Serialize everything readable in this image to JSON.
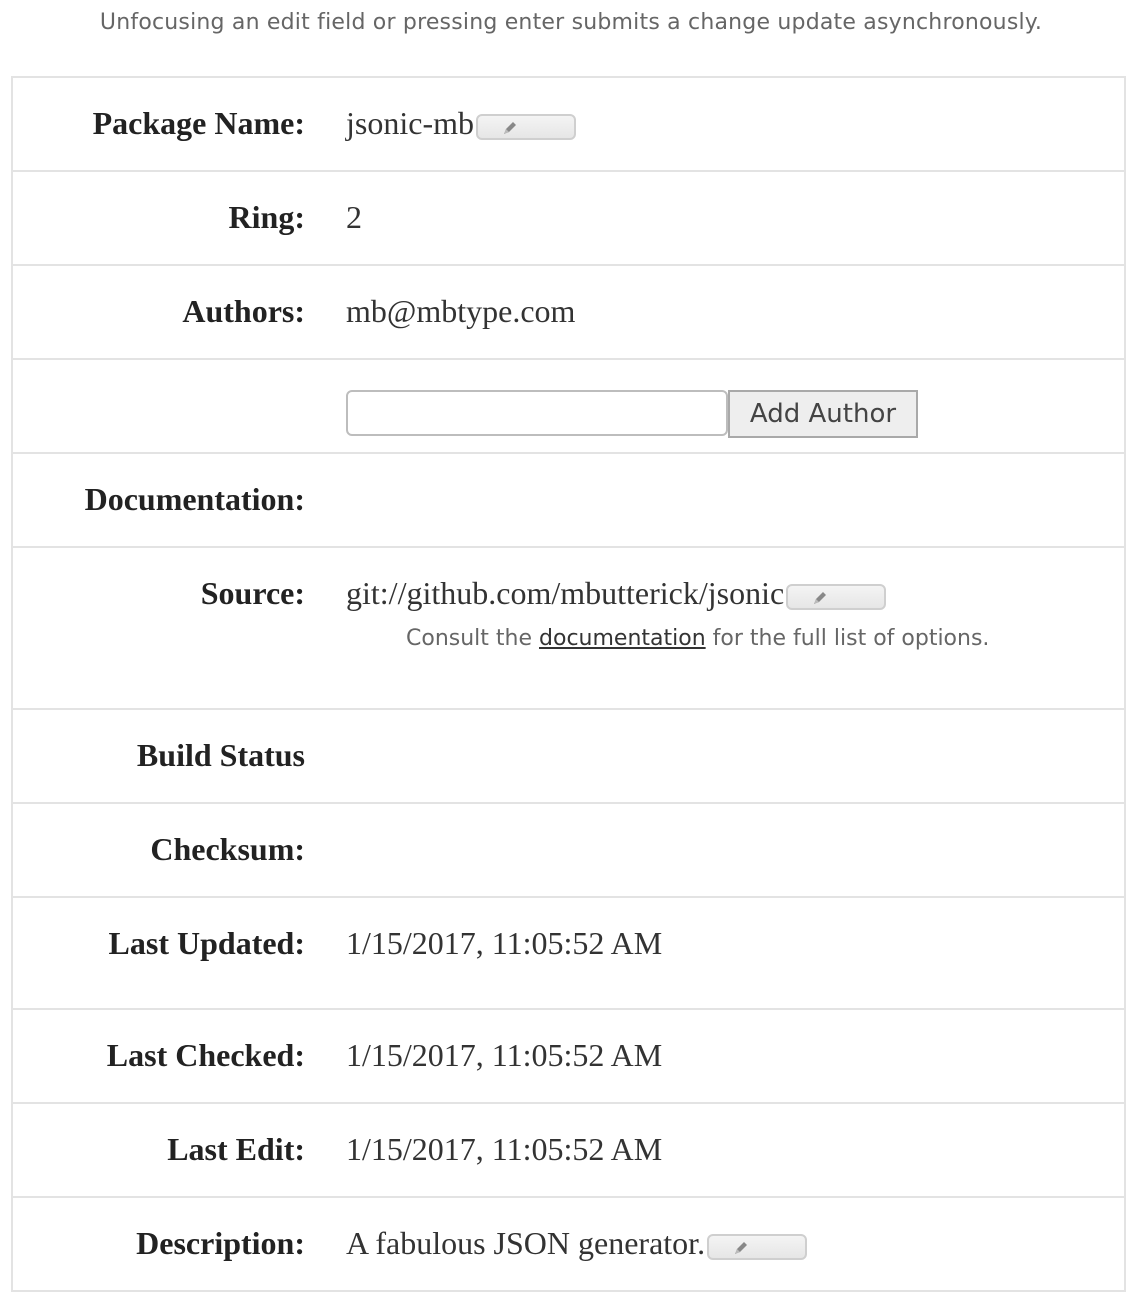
{
  "notice": "Unfocusing an edit field or pressing enter submits a change update asynchronously.",
  "fields": {
    "package_name": {
      "label": "Package Name:",
      "value": "jsonic-mb"
    },
    "ring": {
      "label": "Ring:",
      "value": "2"
    },
    "authors": {
      "label": "Authors:",
      "value": "mb@mbtype.com"
    },
    "add_author": {
      "input_value": "",
      "button_label": "Add Author"
    },
    "documentation": {
      "label": "Documentation:",
      "value": ""
    },
    "source": {
      "label": "Source:",
      "value": "git://github.com/mbutterick/jsonic",
      "hint_prefix": "Consult the",
      "hint_link": "documentation",
      "hint_suffix": "for the full list of options."
    },
    "build_status": {
      "label": "Build Status",
      "value": ""
    },
    "checksum": {
      "label": "Checksum:",
      "value": ""
    },
    "last_updated": {
      "label": "Last Updated:",
      "value": "1/15/2017, 11:05:52 AM"
    },
    "last_checked": {
      "label": "Last Checked:",
      "value": "1/15/2017, 11:05:52 AM"
    },
    "last_edit": {
      "label": "Last Edit:",
      "value": "1/15/2017, 11:05:52 AM"
    },
    "description": {
      "label": "Description:",
      "value": "A fabulous JSON generator."
    }
  },
  "icons": {
    "edit": "pencil-icon"
  }
}
